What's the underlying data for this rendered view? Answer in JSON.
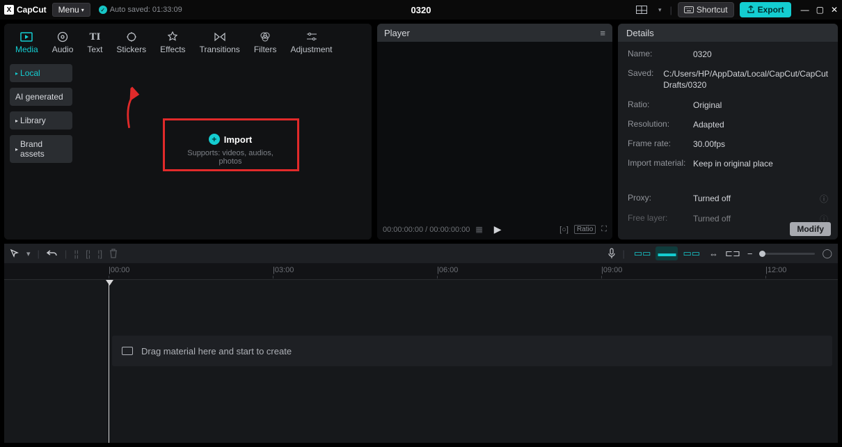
{
  "app": {
    "name": "CapCut",
    "menu_label": "Menu",
    "autosave": "Auto saved: 01:33:09",
    "project_title": "0320"
  },
  "topbar": {
    "shortcut_label": "Shortcut",
    "export_label": "Export"
  },
  "tabs": [
    {
      "label": "Media",
      "id": "media"
    },
    {
      "label": "Audio",
      "id": "audio"
    },
    {
      "label": "Text",
      "id": "text"
    },
    {
      "label": "Stickers",
      "id": "stickers"
    },
    {
      "label": "Effects",
      "id": "effects"
    },
    {
      "label": "Transitions",
      "id": "transitions"
    },
    {
      "label": "Filters",
      "id": "filters"
    },
    {
      "label": "Adjustment",
      "id": "adjustment"
    }
  ],
  "sidebar": {
    "items": [
      {
        "label": "Local",
        "active": true
      },
      {
        "label": "AI generated",
        "active": false
      },
      {
        "label": "Library",
        "active": false
      },
      {
        "label": "Brand assets",
        "active": false
      }
    ]
  },
  "import": {
    "label": "Import",
    "subtext": "Supports: videos, audios, photos"
  },
  "player": {
    "title": "Player",
    "time": "00:00:00:00 / 00:00:00:00",
    "ratio_label": "Ratio"
  },
  "details": {
    "title": "Details",
    "rows": {
      "name": {
        "label": "Name:",
        "value": "0320"
      },
      "saved": {
        "label": "Saved:",
        "value": "C:/Users/HP/AppData/Local/CapCut/CapCut Drafts/0320"
      },
      "ratio": {
        "label": "Ratio:",
        "value": "Original"
      },
      "resolution": {
        "label": "Resolution:",
        "value": "Adapted"
      },
      "framerate": {
        "label": "Frame rate:",
        "value": "30.00fps"
      },
      "import_material": {
        "label": "Import material:",
        "value": "Keep in original place"
      },
      "proxy": {
        "label": "Proxy:",
        "value": "Turned off"
      },
      "freelayer": {
        "label": "Free layer:",
        "value": "Turned off"
      }
    },
    "modify_label": "Modify"
  },
  "timeline": {
    "ruler": [
      "|00:00",
      "|03:00",
      "|06:00",
      "|09:00",
      "|12:00"
    ],
    "drop_hint": "Drag material here and start to create"
  }
}
